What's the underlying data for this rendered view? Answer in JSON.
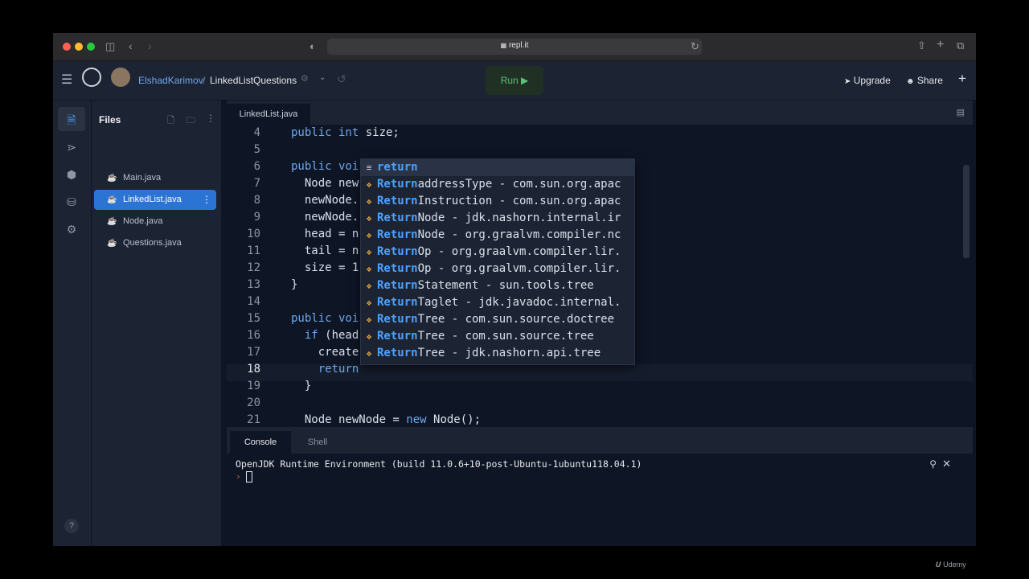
{
  "browser": {
    "url": "repl.it",
    "lock_icon": "lock-icon"
  },
  "header": {
    "username": "ElshadKarimov",
    "separator": "/",
    "repl_name": "LinkedListQuestions",
    "run_label": "Run ▶",
    "upgrade_label": "Upgrade",
    "share_label": "Share",
    "plus": "+"
  },
  "sidebar": {
    "title": "Files",
    "files": [
      "Main.java",
      "LinkedList.java",
      "Node.java",
      "Questions.java"
    ],
    "active_file": "LinkedList.java",
    "help": "?"
  },
  "editor": {
    "tab": "LinkedList.java",
    "lines": [
      {
        "n": "4",
        "parts": [
          {
            "t": "public int ",
            "k": true
          },
          {
            "t": "size;"
          }
        ]
      },
      {
        "n": "5",
        "parts": []
      },
      {
        "n": "6",
        "parts": [
          {
            "t": "public voi",
            "k": true
          }
        ]
      },
      {
        "n": "7",
        "parts": [
          {
            "t": "  Node new"
          }
        ]
      },
      {
        "n": "8",
        "parts": [
          {
            "t": "  newNode."
          }
        ]
      },
      {
        "n": "9",
        "parts": [
          {
            "t": "  newNode."
          }
        ]
      },
      {
        "n": "10",
        "parts": [
          {
            "t": "  head = n"
          }
        ]
      },
      {
        "n": "11",
        "parts": [
          {
            "t": "  tail = n"
          }
        ]
      },
      {
        "n": "12",
        "parts": [
          {
            "t": "  size = 1"
          }
        ]
      },
      {
        "n": "13",
        "parts": [
          {
            "t": "}"
          }
        ]
      },
      {
        "n": "14",
        "parts": []
      },
      {
        "n": "15",
        "parts": [
          {
            "t": "public voi",
            "k": true
          }
        ]
      },
      {
        "n": "16",
        "parts": [
          {
            "t": "  "
          },
          {
            "t": "if",
            "k": true
          },
          {
            "t": " (head"
          }
        ]
      },
      {
        "n": "17",
        "parts": [
          {
            "t": "    create"
          }
        ]
      },
      {
        "n": "18",
        "parts": [
          {
            "t": "    "
          },
          {
            "t": "return",
            "k": true
          }
        ]
      },
      {
        "n": "19",
        "parts": [
          {
            "t": "  }"
          }
        ]
      },
      {
        "n": "20",
        "parts": []
      },
      {
        "n": "21",
        "parts": [
          {
            "t": "  Node newNode = "
          },
          {
            "t": "new",
            "k": true
          },
          {
            "t": " Node();"
          }
        ]
      }
    ],
    "autocomplete": [
      {
        "hl": "return",
        "rest": "",
        "icon": "keyword-icon"
      },
      {
        "hl": "Return",
        "rest": "addressType - com.sun.org.apac",
        "icon": "class-icon"
      },
      {
        "hl": "Return",
        "rest": "Instruction - com.sun.org.apac",
        "icon": "class-icon"
      },
      {
        "hl": "Return",
        "rest": "Node - jdk.nashorn.internal.ir",
        "icon": "class-icon"
      },
      {
        "hl": "Return",
        "rest": "Node - org.graalvm.compiler.nc",
        "icon": "class-icon"
      },
      {
        "hl": "Return",
        "rest": "Op - org.graalvm.compiler.lir.",
        "icon": "class-icon"
      },
      {
        "hl": "Return",
        "rest": "Op - org.graalvm.compiler.lir.",
        "icon": "class-icon"
      },
      {
        "hl": "Return",
        "rest": "Statement - sun.tools.tree",
        "icon": "class-icon"
      },
      {
        "hl": "Return",
        "rest": "Taglet - jdk.javadoc.internal.",
        "icon": "class-icon"
      },
      {
        "hl": "Return",
        "rest": "Tree - com.sun.source.doctree",
        "icon": "class-icon"
      },
      {
        "hl": "Return",
        "rest": "Tree - com.sun.source.tree",
        "icon": "class-icon"
      },
      {
        "hl": "Return",
        "rest": "Tree - jdk.nashorn.api.tree",
        "icon": "class-icon"
      }
    ]
  },
  "console": {
    "tabs": [
      "Console",
      "Shell"
    ],
    "active_tab": "Console",
    "output": "OpenJDK Runtime Environment (build 11.0.6+10-post-Ubuntu-1ubuntu118.04.1)",
    "prompt": "›"
  },
  "watermark": "Udemy",
  "colors": {
    "accent": "#2c74d4",
    "run_green": "#58c472",
    "keyword": "#6fa8e8",
    "autocomplete_highlight": "#4aa3ff"
  }
}
